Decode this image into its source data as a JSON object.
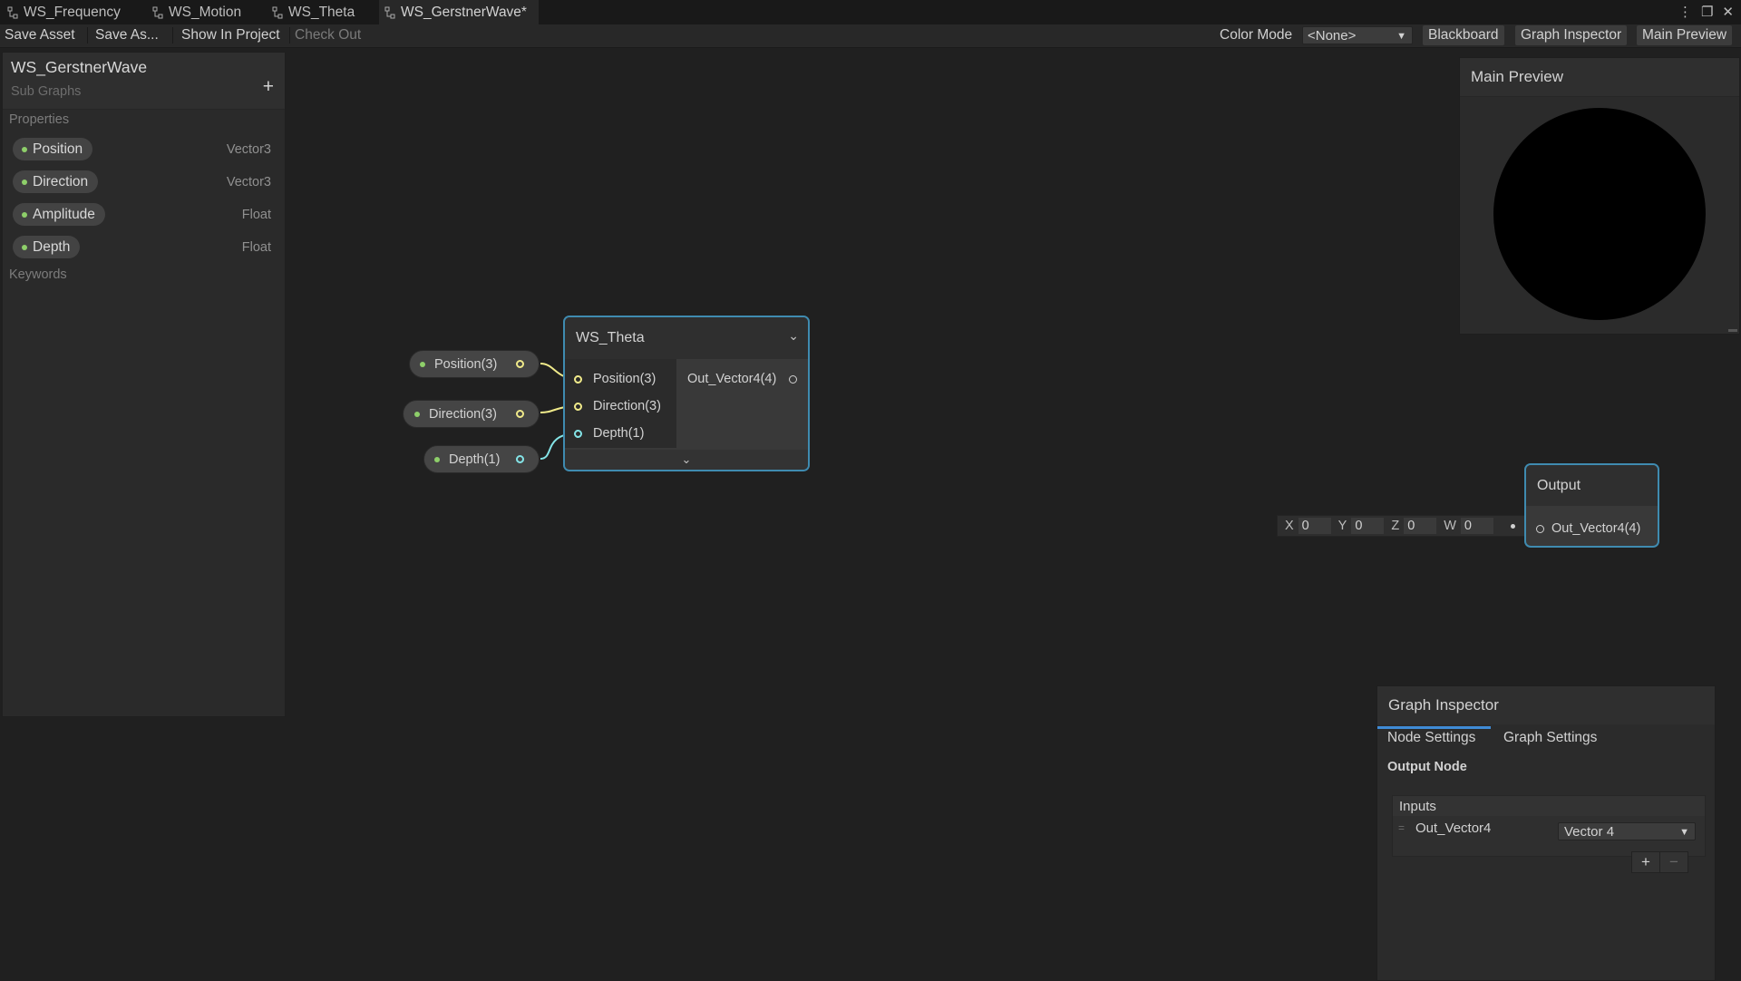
{
  "tabs": [
    {
      "label": "WS_Frequency"
    },
    {
      "label": "WS_Motion"
    },
    {
      "label": "WS_Theta"
    },
    {
      "label": "WS_GerstnerWave*"
    }
  ],
  "toolbar": {
    "save_asset": "Save Asset",
    "save_as": "Save As...",
    "show_in_project": "Show In Project",
    "check_out": "Check Out",
    "color_mode_label": "Color Mode",
    "color_mode_value": "<None>",
    "blackboard": "Blackboard",
    "graph_inspector": "Graph Inspector",
    "main_preview": "Main Preview"
  },
  "blackboard": {
    "title": "WS_GerstnerWave",
    "subtitle": "Sub Graphs",
    "add": "+",
    "properties_header": "Properties",
    "properties": [
      {
        "name": "Position",
        "type": "Vector3"
      },
      {
        "name": "Direction",
        "type": "Vector3"
      },
      {
        "name": "Amplitude",
        "type": "Float"
      },
      {
        "name": "Depth",
        "type": "Float"
      }
    ],
    "keywords_header": "Keywords"
  },
  "graph": {
    "property_nodes": [
      "Position(3)",
      "Direction(3)",
      "Depth(1)"
    ],
    "theta_node": {
      "title": "WS_Theta",
      "inputs": [
        "Position(3)",
        "Direction(3)",
        "Depth(1)"
      ],
      "output": "Out_Vector4(4)"
    },
    "output_node": {
      "title": "Output",
      "input": "Out_Vector4(4)"
    },
    "vector4_field": {
      "x_label": "X",
      "x": "0",
      "y_label": "Y",
      "y": "0",
      "z_label": "Z",
      "z": "0",
      "w_label": "W",
      "w": "0"
    }
  },
  "main_preview": {
    "title": "Main Preview"
  },
  "inspector": {
    "title": "Graph Inspector",
    "tab_node": "Node Settings",
    "tab_graph": "Graph Settings",
    "section": "Output Node",
    "inputs_header": "Inputs",
    "input_name": "Out_Vector4",
    "input_type": "Vector 4",
    "add": "+",
    "remove": "−"
  },
  "colors": {
    "vector3_wire": "#f0ea8a",
    "float_wire": "#84e4e7",
    "selection": "#3f8bb0",
    "property_dot": "#8ecf6a"
  }
}
